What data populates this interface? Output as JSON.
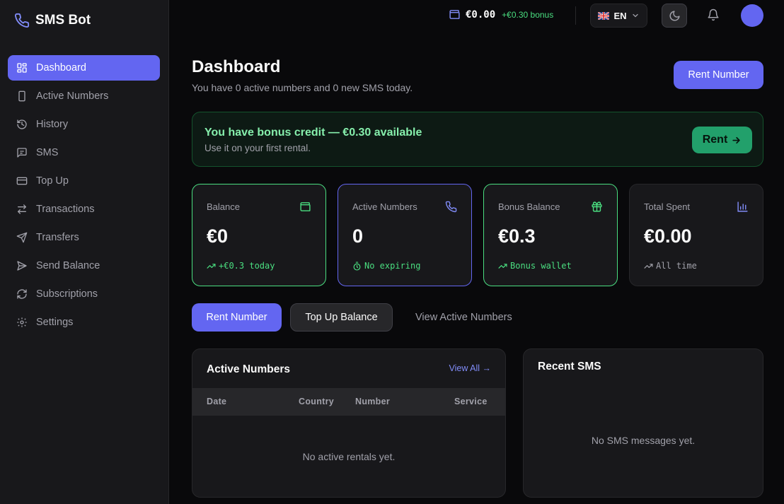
{
  "app": {
    "name": "SMS Bot"
  },
  "colors": {
    "accent": "#6366f1",
    "success": "#4ade80",
    "bg": "#09090b",
    "surface": "#18181b",
    "border": "#27272a",
    "muted": "#a1a1aa"
  },
  "sidebar": {
    "items": [
      {
        "label": "Dashboard",
        "icon": "dashboard-icon",
        "active": true
      },
      {
        "label": "Active Numbers",
        "icon": "phone-device-icon"
      },
      {
        "label": "History",
        "icon": "history-icon"
      },
      {
        "label": "SMS",
        "icon": "message-icon"
      },
      {
        "label": "Top Up",
        "icon": "credit-card-icon"
      },
      {
        "label": "Transactions",
        "icon": "transfer-arrows-icon"
      },
      {
        "label": "Transfers",
        "icon": "send-plane-icon"
      },
      {
        "label": "Send Balance",
        "icon": "send-icon"
      },
      {
        "label": "Subscriptions",
        "icon": "refresh-icon"
      },
      {
        "label": "Settings",
        "icon": "gear-icon"
      }
    ]
  },
  "topbar": {
    "wallet_amount": "€0.00",
    "wallet_bonus": "+€0.30 bonus",
    "language": "EN"
  },
  "header": {
    "title": "Dashboard",
    "subtitle": "You have 0 active numbers and 0 new SMS today.",
    "rent_button": "Rent Number"
  },
  "bonus_banner": {
    "title": "You have bonus credit — €0.30 available",
    "subtitle": "Use it on your first rental.",
    "button": "Rent"
  },
  "stats": [
    {
      "label": "Balance",
      "value": "€0",
      "sub": "+€0.3 today",
      "icon": "wallet-icon"
    },
    {
      "label": "Active Numbers",
      "value": "0",
      "sub": "No expiring",
      "icon": "phone-icon"
    },
    {
      "label": "Bonus Balance",
      "value": "€0.3",
      "sub": "Bonus wallet",
      "icon": "gift-icon"
    },
    {
      "label": "Total Spent",
      "value": "€0.00",
      "sub": "All time",
      "icon": "bar-chart-icon"
    }
  ],
  "quick_actions": {
    "rent": "Rent Number",
    "top_up": "Top Up Balance",
    "view_active": "View Active Numbers"
  },
  "active_numbers": {
    "title": "Active Numbers",
    "view_all": "View All →",
    "columns": [
      "Date",
      "Country",
      "Number",
      "Service"
    ],
    "empty": "No active rentals yet."
  },
  "recent_sms": {
    "title": "Recent SMS",
    "empty": "No SMS messages yet."
  }
}
